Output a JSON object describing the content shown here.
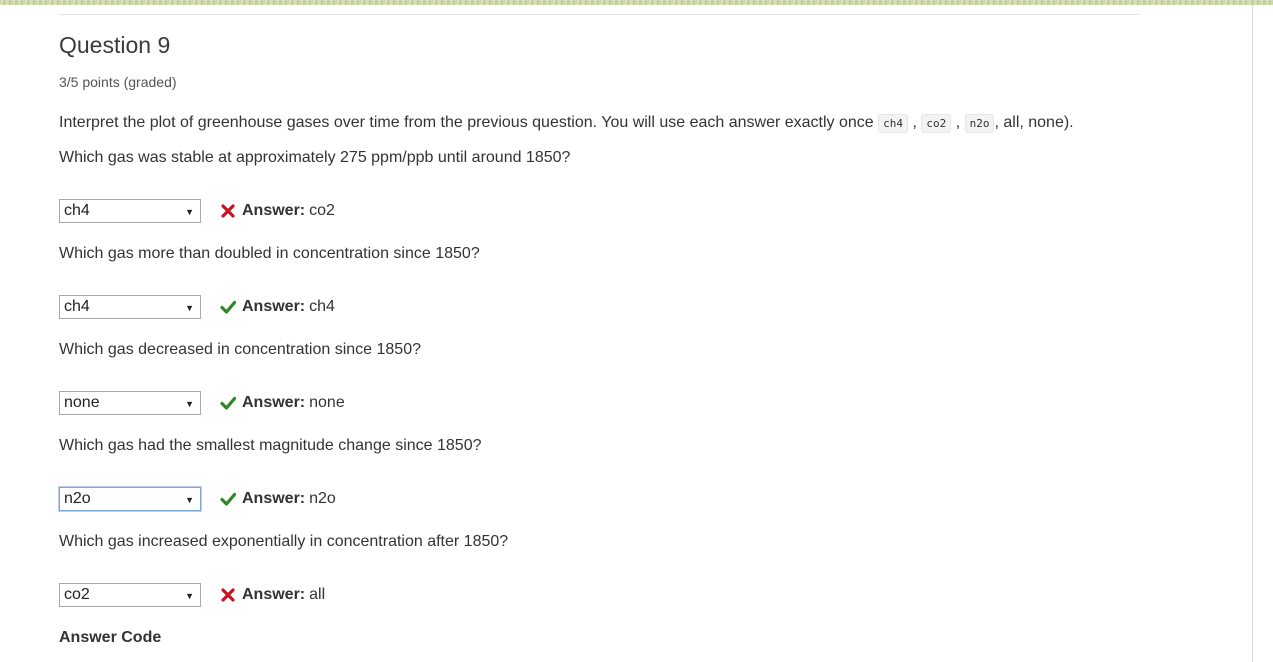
{
  "question": {
    "title": "Question 9",
    "points": "3/5 points (graded)",
    "intro_prefix": "Interpret the plot of greenhouse gases over time from the previous question. You will use each answer exactly once",
    "intro_codes": [
      "ch4",
      "co2",
      "n2o"
    ],
    "intro_suffix": ", all, none)."
  },
  "items": [
    {
      "prompt": "Which gas was stable at approximately 275 ppm/ppb until around 1850?",
      "selected": "ch4",
      "result": "incorrect",
      "answer_label": "Answer:",
      "answer": "co2"
    },
    {
      "prompt": "Which gas more than doubled in concentration since 1850?",
      "selected": "ch4",
      "result": "correct",
      "answer_label": "Answer:",
      "answer": "ch4"
    },
    {
      "prompt": "Which gas decreased in concentration since 1850?",
      "selected": "none",
      "result": "correct",
      "answer_label": "Answer:",
      "answer": "none"
    },
    {
      "prompt": "Which gas had the smallest magnitude change since 1850?",
      "selected": "n2o",
      "result": "correct",
      "answer_label": "Answer:",
      "answer": "n2o"
    },
    {
      "prompt": "Which gas increased exponentially in concentration after 1850?",
      "selected": "co2",
      "result": "incorrect",
      "answer_label": "Answer:",
      "answer": "all"
    }
  ],
  "footer": {
    "answer_code_heading": "Answer Code"
  },
  "colors": {
    "correct": "#2a8a1f",
    "incorrect": "#c4161c",
    "focus": "#7ea6d9"
  },
  "icons": {
    "correct": "checkmark-icon",
    "incorrect": "x-icon",
    "dropdown": "caret-down-icon"
  }
}
